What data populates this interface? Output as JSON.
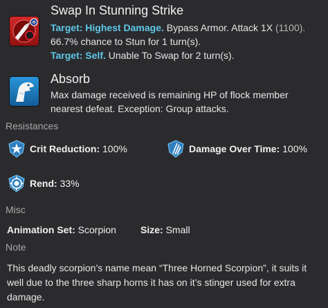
{
  "abilities": [
    {
      "name": "Swap In Stunning Strike",
      "icon": "stunning-strike-icon",
      "lines": [
        {
          "label": "Target: Highest Damage.",
          "text": " Bypass Armor. Attack 1X ",
          "extra": "(1100)."
        },
        {
          "label": "",
          "text": "66.7% chance to Stun for 1 turn(s)."
        },
        {
          "label": "Target: Self.",
          "text": " Unable To Swap for 2 turn(s)."
        }
      ]
    },
    {
      "name": "Absorb",
      "icon": "absorb-icon",
      "lines": [
        {
          "text": "Max damage received is remaining HP of flock member"
        },
        {
          "text": "nearest defeat. Exception: Group attacks."
        }
      ]
    }
  ],
  "resistances": {
    "section_label": "Resistances",
    "items": [
      {
        "label": "Crit Reduction:",
        "value": "100%",
        "icon": "crit-reduction-icon"
      },
      {
        "label": "Damage Over Time:",
        "value": "100%",
        "icon": "damage-over-time-icon"
      },
      {
        "label": "Rend:",
        "value": "33%",
        "icon": "rend-icon"
      }
    ]
  },
  "misc": {
    "section_label": "Misc",
    "animation_label": "Animation Set:",
    "animation_value": "Scorpion",
    "size_label": "Size:",
    "size_value": "Small"
  },
  "note": {
    "section_label": "Note",
    "lines": [
      "This deadly scorpion’s name mean “Three Horned Scorpion”, it suits it",
      "well due to the three sharp horns it has on it’s stinger used for extra",
      "damage."
    ]
  },
  "colors": {
    "background": "#2b2b2e",
    "highlight": "#5ec8e8",
    "section_label": "#a8a8a8",
    "stun_icon_bg": "#c01f1f",
    "absorb_icon_bg": "#1c7fc4"
  }
}
